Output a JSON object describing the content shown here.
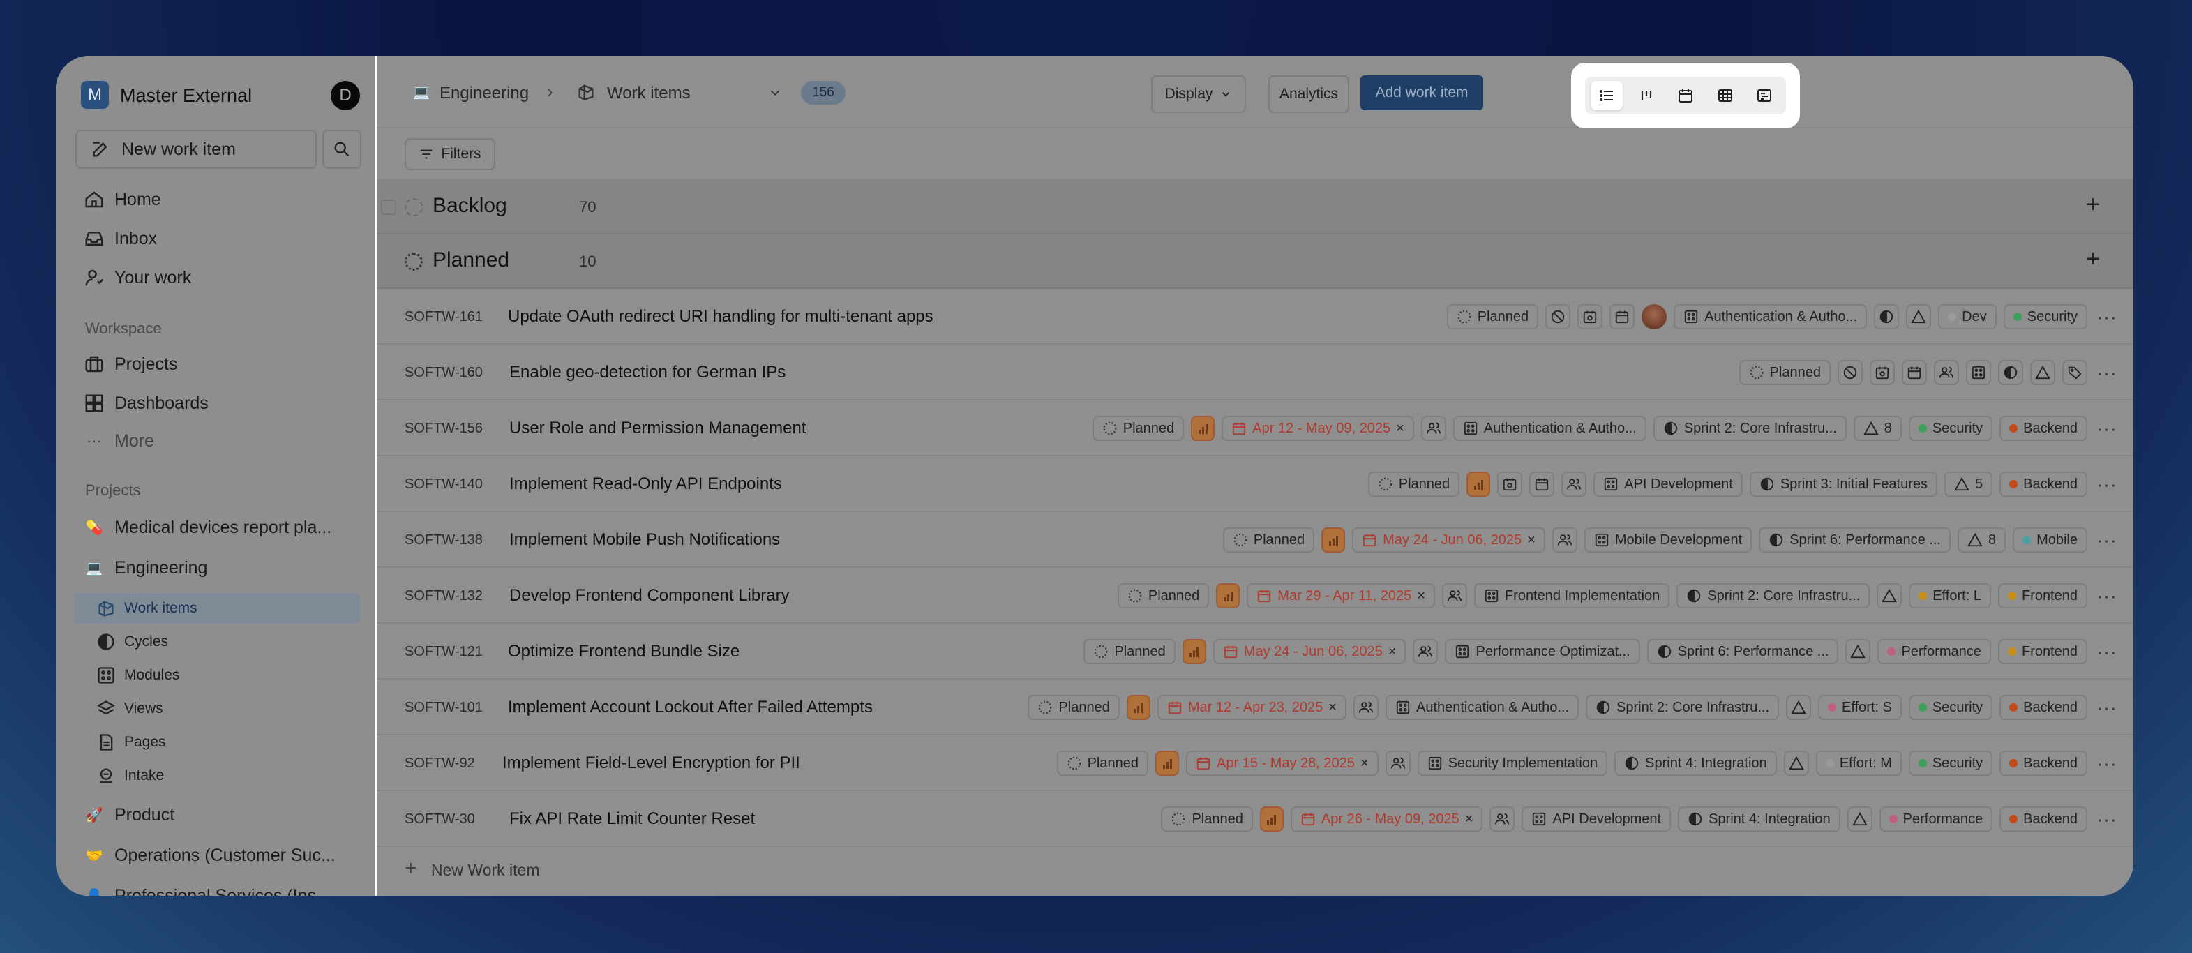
{
  "workspace": {
    "name": "Master External",
    "initial": "M",
    "user_initial": "D"
  },
  "sidebar": {
    "new_item": "New work item",
    "nav": [
      "Home",
      "Inbox",
      "Your work"
    ],
    "workspace_label": "Workspace",
    "workspace_items": [
      "Projects",
      "Dashboards",
      "More"
    ],
    "projects_label": "Projects",
    "projects": [
      {
        "name": "Medical devices report pla...",
        "emoji": "💊"
      },
      {
        "name": "Engineering",
        "emoji": "💻"
      },
      {
        "name": "Product",
        "emoji": "🚀"
      },
      {
        "name": "Operations (Customer Suc...",
        "emoji": "🤝"
      },
      {
        "name": "Professional Services (Ins...",
        "emoji": "👤"
      }
    ],
    "engineering_sub": [
      "Work items",
      "Cycles",
      "Modules",
      "Views",
      "Pages",
      "Intake"
    ]
  },
  "header": {
    "project": "Engineering",
    "page": "Work items",
    "count": "156",
    "display": "Display",
    "analytics": "Analytics",
    "add": "Add work item",
    "filters": "Filters",
    "layouts": [
      "list-view-icon",
      "kanban-view-icon",
      "calendar-view-icon",
      "spreadsheet-view-icon",
      "gantt-view-icon"
    ]
  },
  "groups": {
    "backlog": {
      "name": "Backlog",
      "count": "70"
    },
    "planned": {
      "name": "Planned",
      "count": "10"
    }
  },
  "new_work_item": "New Work item",
  "rows": [
    {
      "id": "SOFTW-161",
      "title": "Update OAuth redirect URI handling for multi-tenant apps",
      "state": "Planned",
      "priority": "none",
      "date": "",
      "module": "Authentication & Autho...",
      "cycle": "",
      "estimate": "",
      "labels": [
        {
          "t": "Dev",
          "c": "#9a9a9a"
        },
        {
          "t": "Security",
          "c": "#3aa05a"
        }
      ],
      "avatar": true,
      "sprint_icon": true
    },
    {
      "id": "SOFTW-160",
      "title": "Enable geo-detection for German IPs",
      "state": "Planned",
      "priority": "none",
      "date": "",
      "module": "",
      "cycle": "",
      "estimate": "",
      "labels": [],
      "avatar": false,
      "sprint_icon": true,
      "label_icon": true
    },
    {
      "id": "SOFTW-156",
      "title": "User Role and Permission Management",
      "state": "Planned",
      "priority": "high",
      "date": "Apr 12 - May 09, 2025",
      "module": "Authentication & Autho...",
      "cycle": "Sprint 2: Core Infrastru...",
      "estimate": "8",
      "labels": [
        {
          "t": "Security",
          "c": "#3aa05a"
        },
        {
          "t": "Backend",
          "c": "#c04a1a"
        }
      ]
    },
    {
      "id": "SOFTW-140",
      "title": "Implement Read-Only API Endpoints",
      "state": "Planned",
      "priority": "medium",
      "date": "",
      "module": "API Development",
      "cycle": "Sprint 3: Initial Features",
      "estimate": "5",
      "labels": [
        {
          "t": "Backend",
          "c": "#c04a1a"
        }
      ]
    },
    {
      "id": "SOFTW-138",
      "title": "Implement Mobile Push Notifications",
      "state": "Planned",
      "priority": "medium",
      "date": "May 24 - Jun 06, 2025",
      "module": "Mobile Development",
      "cycle": "Sprint 6: Performance ...",
      "estimate": "8",
      "labels": [
        {
          "t": "Mobile",
          "c": "#4aa0a0"
        }
      ]
    },
    {
      "id": "SOFTW-132",
      "title": "Develop Frontend Component Library",
      "state": "Planned",
      "priority": "high",
      "date": "Mar 29 - Apr 11, 2025",
      "module": "Frontend Implementation",
      "cycle": "Sprint 2: Core Infrastru...",
      "estimate": "",
      "labels": [
        {
          "t": "Effort: L",
          "c": "#c8901a"
        },
        {
          "t": "Frontend",
          "c": "#c8901a"
        }
      ]
    },
    {
      "id": "SOFTW-121",
      "title": "Optimize Frontend Bundle Size",
      "state": "Planned",
      "priority": "medium",
      "date": "May 24 - Jun 06, 2025",
      "module": "Performance Optimizat...",
      "cycle": "Sprint 6: Performance ...",
      "estimate": "",
      "labels": [
        {
          "t": "Performance",
          "c": "#c06080"
        },
        {
          "t": "Frontend",
          "c": "#c8901a"
        }
      ]
    },
    {
      "id": "SOFTW-101",
      "title": "Implement Account Lockout After Failed Attempts",
      "state": "Planned",
      "priority": "high",
      "date": "Mar 12 - Apr 23, 2025",
      "module": "Authentication & Autho...",
      "cycle": "Sprint 2: Core Infrastru...",
      "estimate": "",
      "labels": [
        {
          "t": "Effort: S",
          "c": "#c06080"
        },
        {
          "t": "Security",
          "c": "#3aa05a"
        },
        {
          "t": "Backend",
          "c": "#c04a1a"
        }
      ]
    },
    {
      "id": "SOFTW-92",
      "title": "Implement Field-Level Encryption for PII",
      "state": "Planned",
      "priority": "high",
      "date": "Apr 15 - May 28, 2025",
      "module": "Security Implementation",
      "cycle": "Sprint 4: Integration",
      "estimate": "",
      "labels": [
        {
          "t": "Effort: M",
          "c": "#9a9a9a"
        },
        {
          "t": "Security",
          "c": "#3aa05a"
        },
        {
          "t": "Backend",
          "c": "#c04a1a"
        }
      ]
    },
    {
      "id": "SOFTW-30",
      "title": "Fix API Rate Limit Counter Reset",
      "state": "Planned",
      "priority": "high",
      "date": "Apr 26 - May 09, 2025",
      "module": "API Development",
      "cycle": "Sprint 4: Integration",
      "estimate": "",
      "labels": [
        {
          "t": "Performance",
          "c": "#c06080"
        },
        {
          "t": "Backend",
          "c": "#c04a1a"
        }
      ]
    }
  ]
}
